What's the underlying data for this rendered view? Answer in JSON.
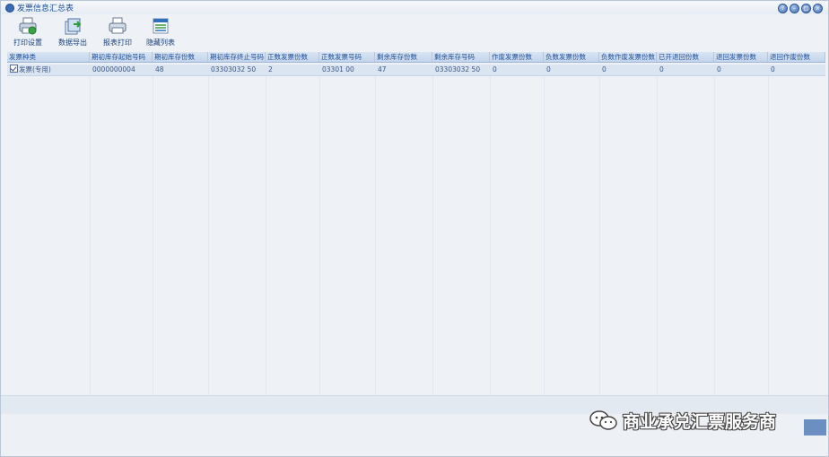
{
  "window": {
    "title": "发票信息汇总表"
  },
  "toolbar": {
    "print_setup": "打印设置",
    "export": "数据导出",
    "print": "报表打印",
    "hide_list": "隐藏列表"
  },
  "table": {
    "columns": [
      "发票种类",
      "期初库存起始号码",
      "期初库存份数",
      "期初库存终止号码",
      "正数发票份数",
      "正数发票号码",
      "剩余库存份数",
      "剩余库存号码",
      "作废发票份数",
      "负数发票份数",
      "负数作废发票份数",
      "已开退回份数",
      "退回发票份数",
      "退回作废份数"
    ],
    "rows": [
      [
        "发票(专用)",
        "0000000004",
        "48",
        "03303032 50",
        "2",
        "03301 00",
        "47",
        "03303032 50",
        "0",
        "0",
        "0",
        "0",
        "0",
        "0"
      ]
    ]
  },
  "watermark": {
    "text": "商业承兑汇票服务商",
    "icon": "wechat-icon"
  },
  "colors": {
    "header_bg": "#c3d5ec",
    "selected_row": "#dbe5f2",
    "background": "#eef2f7",
    "accent": "#1f4f98"
  }
}
